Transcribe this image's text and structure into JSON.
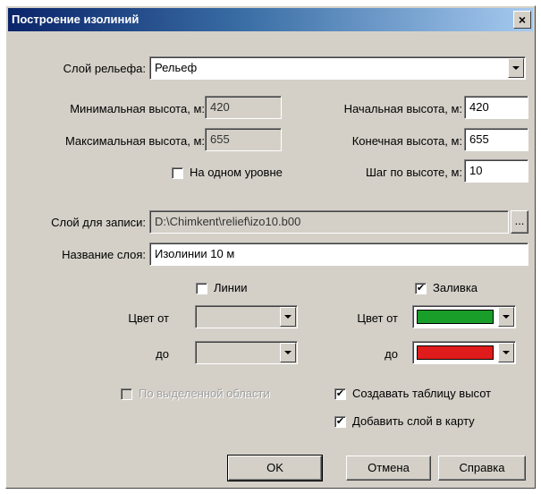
{
  "dialog": {
    "title": "Построение изолиний",
    "close_glyph": "×"
  },
  "relief": {
    "label": "Слой рельефа:",
    "value": "Рельеф"
  },
  "min_height": {
    "label": "Минимальная высота, м:",
    "value": "420"
  },
  "max_height": {
    "label": "Максимальная высота, м:",
    "value": "655"
  },
  "start_height": {
    "label": "Начальная высота, м:",
    "value": "420"
  },
  "end_height": {
    "label": "Конечная высота, м:",
    "value": "655"
  },
  "one_level": {
    "label": "На одном уровне",
    "checked": false
  },
  "step": {
    "label": "Шаг по высоте, м:",
    "value": "10"
  },
  "write_layer": {
    "label": "Слой для записи:",
    "value": "D:\\Chimkent\\relief\\izo10.b00",
    "browse_label": "..."
  },
  "layer_name": {
    "label": "Название слоя:",
    "value": "Изолинии 10 м"
  },
  "lines": {
    "label": "Линии",
    "checked": false,
    "color_from_label": "Цвет от",
    "color_to_label": "до"
  },
  "fill": {
    "label": "Заливка",
    "checked": true,
    "check_glyph": "✔",
    "color_from_label": "Цвет от",
    "color_to_label": "до",
    "color_from": "#1a9e2a",
    "color_to": "#e01b1b"
  },
  "options": {
    "selected_area": {
      "label": "По выделенной области",
      "checked": false,
      "enabled": false
    },
    "create_table": {
      "label": "Создавать таблицу высот",
      "checked": true,
      "check_glyph": "✔"
    },
    "add_to_map": {
      "label": "Добавить слой в карту",
      "checked": true,
      "check_glyph": "✔"
    }
  },
  "buttons": {
    "ok": "OK",
    "cancel": "Отмена",
    "help": "Справка"
  }
}
